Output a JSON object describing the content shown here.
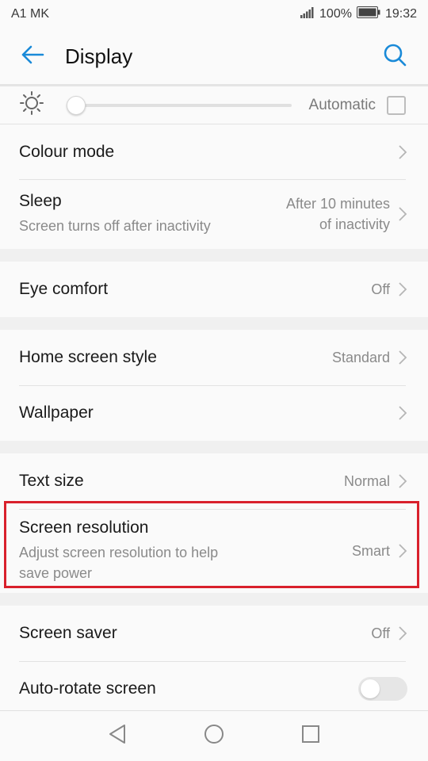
{
  "status": {
    "carrier": "A1 MK",
    "battery": "100%",
    "time": "19:32"
  },
  "header": {
    "title": "Display"
  },
  "brightness": {
    "auto_label": "Automatic",
    "auto_checked": false,
    "level": 0.0
  },
  "rows": {
    "colour_mode": {
      "label": "Colour mode"
    },
    "sleep": {
      "label": "Sleep",
      "sub": "Screen turns off after inactivity",
      "value_line1": "After 10 minutes",
      "value_line2": "of inactivity"
    },
    "eye_comfort": {
      "label": "Eye comfort",
      "value": "Off"
    },
    "home_screen_style": {
      "label": "Home screen style",
      "value": "Standard"
    },
    "wallpaper": {
      "label": "Wallpaper"
    },
    "text_size": {
      "label": "Text size",
      "value": "Normal"
    },
    "screen_resolution": {
      "label": "Screen resolution",
      "sub_line1": "Adjust screen resolution to help",
      "sub_line2": "save power",
      "value": "Smart"
    },
    "screen_saver": {
      "label": "Screen saver",
      "value": "Off"
    },
    "auto_rotate": {
      "label": "Auto-rotate screen",
      "enabled": false
    }
  },
  "icons": {
    "back": "arrow-left-icon",
    "search": "search-icon",
    "brightness": "sun-icon",
    "chevron": "chevron-right-icon",
    "nav_back": "triangle-back-icon",
    "nav_home": "circle-home-icon",
    "nav_recents": "square-recents-icon"
  },
  "colors": {
    "accent": "#1a8ad8",
    "highlight_border": "#d9202c"
  }
}
